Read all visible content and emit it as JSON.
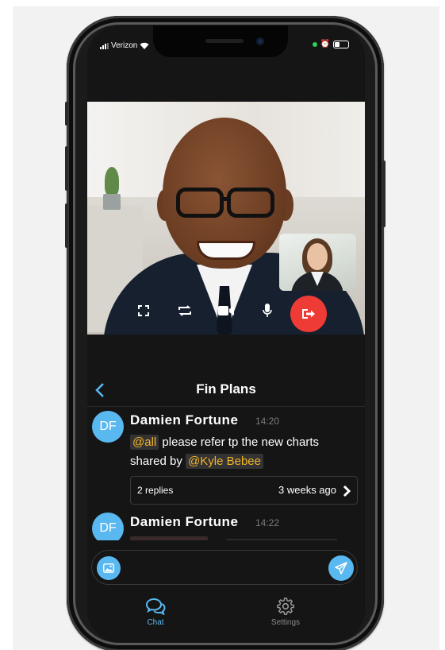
{
  "status_bar": {
    "carrier": "Verizon"
  },
  "call": {
    "controls": [
      "fullscreen-icon",
      "switch-camera-icon",
      "video-camera-icon",
      "microphone-icon",
      "leave-call-icon"
    ],
    "hangup_color": "#ef3b36"
  },
  "chat": {
    "title": "Fin Plans",
    "accent_color": "#5ab8f0",
    "mention_color": "#f3b52a",
    "messages": [
      {
        "avatar": "DF",
        "name": "Damien Fortune",
        "time": "14:20",
        "mention_all": "@all",
        "text_part1": "please refer tp the new charts shared by",
        "mention_user": "@Kyle Bebee",
        "replies_count": "2 replies",
        "replies_time": "3 weeks ago"
      },
      {
        "avatar": "DF",
        "name": "Damien Fortune",
        "time": "14:22"
      }
    ],
    "composer": {
      "placeholder": ""
    }
  },
  "tabs": [
    {
      "label": "Chat",
      "icon": "chat-bubbles-icon",
      "active": true
    },
    {
      "label": "Settings",
      "icon": "gear-icon",
      "active": false
    }
  ]
}
